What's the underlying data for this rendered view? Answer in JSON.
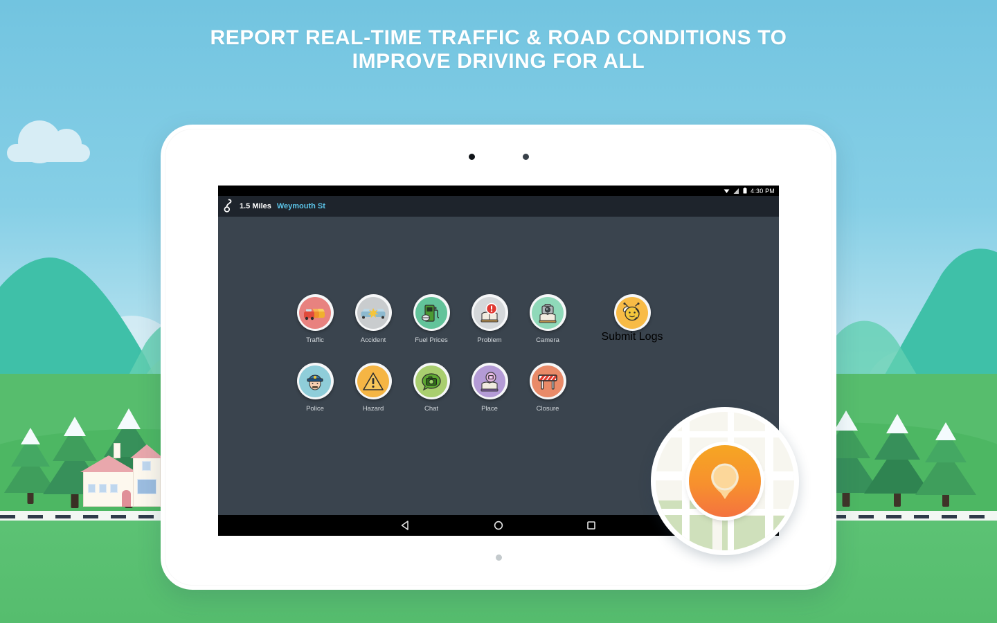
{
  "headline": {
    "line1": "REPORT REAL-TIME TRAFFIC & ROAD CONDITIONS TO",
    "line2": "IMPROVE DRIVING FOR ALL",
    "color": "#ffffff"
  },
  "device": {
    "type": "android-tablet",
    "frame_color": "#ffffff",
    "screen_bg": "#3a444e"
  },
  "status_bar": {
    "time": "4:30 PM",
    "icons": [
      "wifi-icon",
      "signal-icon",
      "battery-icon"
    ],
    "background": "#000000"
  },
  "app_header": {
    "route_icon": "route-icon",
    "distance": "1.5 Miles",
    "street": "Weymouth St",
    "distance_color": "#ffffff",
    "street_color": "#5bc4e8",
    "background": "#1e242c"
  },
  "report_grid": {
    "rows": [
      [
        {
          "label": "Traffic",
          "icon": "traffic-cars-icon",
          "bg": "#e8827f"
        },
        {
          "label": "Accident",
          "icon": "accident-crash-icon",
          "bg": "#c9ccce"
        },
        {
          "label": "Fuel Prices",
          "icon": "fuel-pump-icon",
          "bg": "#62c39a"
        },
        {
          "label": "Problem",
          "icon": "problem-alert-icon",
          "bg": "#d5d8da"
        },
        {
          "label": "Camera",
          "icon": "speed-camera-icon",
          "bg": "#8fd9b9"
        }
      ],
      [
        {
          "label": "Police",
          "icon": "police-officer-icon",
          "bg": "#8fcdd9"
        },
        {
          "label": "Hazard",
          "icon": "hazard-warning-icon",
          "bg": "#f5b544"
        },
        {
          "label": "Chat",
          "icon": "chat-bubble-icon",
          "bg": "#a9ce6f"
        },
        {
          "label": "Place",
          "icon": "place-pin-icon",
          "bg": "#b49bd6"
        },
        {
          "label": "Closure",
          "icon": "road-closure-icon",
          "bg": "#e98a68"
        }
      ]
    ],
    "extra": {
      "label": "Submit Logs",
      "icon": "bee-mascot-icon",
      "bg": "#f8bb46"
    },
    "label_color": "#d5dade"
  },
  "nav_bar": {
    "buttons": [
      {
        "name": "back-button",
        "icon": "triangle-left-icon"
      },
      {
        "name": "home-button",
        "icon": "circle-icon"
      },
      {
        "name": "recents-button",
        "icon": "square-icon"
      }
    ],
    "background": "#000000"
  },
  "map_bubble": {
    "pin_icon": "location-pin-icon",
    "pin_gradient_from": "#f6a623",
    "pin_gradient_to": "#f4733f",
    "map_bg": "#f7f6ef"
  },
  "background_scene": {
    "sky_top": "#72c4e0",
    "sky_bottom": "#d9eef5",
    "grass": "#57bd6d",
    "mountain_teal": "#3fc0a8",
    "mountain_green": "#6ecf8f",
    "road_color": "#f2f7f3",
    "items": [
      "clouds",
      "mountains",
      "pine-trees",
      "houses",
      "road"
    ]
  }
}
